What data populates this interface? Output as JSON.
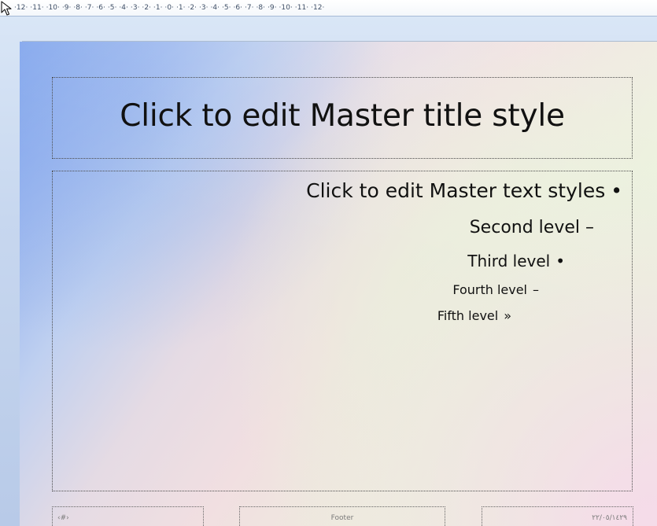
{
  "ruler": {
    "scale_text": "·12·  ·11·  ·10·  ·9·  ·8·  ·7·  ·6·  ·5·  ·4·  ·3·  ·2·  ·1·  ·0·  ·1·  ·2·  ·3·  ·4·  ·5·  ·6·  ·7·  ·8·  ·9·  ·10·  ·11·  ·12·"
  },
  "slide": {
    "title": "Click to edit Master title style",
    "levels": [
      {
        "text": "Click to edit Master text styles",
        "marker": "•"
      },
      {
        "text": "Second level",
        "marker": "–"
      },
      {
        "text": "Third level",
        "marker": "•"
      },
      {
        "text": "Fourth level",
        "marker": "–"
      },
      {
        "text": "Fifth level",
        "marker": "»"
      }
    ],
    "footer": {
      "left": "‹#›",
      "center": "Footer",
      "right": "٢٢/٠٥/١٤٢٩"
    }
  },
  "icons": {
    "cursor": "mouse-pointer-icon"
  }
}
